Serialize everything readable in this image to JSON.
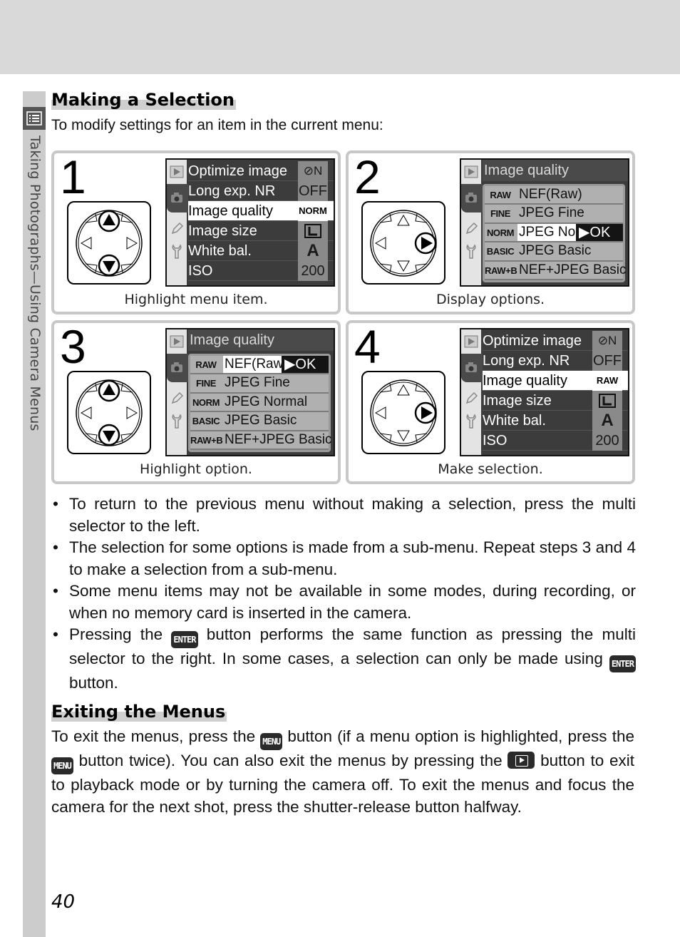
{
  "sidebar": {
    "icon": "menu-list-icon",
    "label": "Taking Photographs—Using Camera Menus"
  },
  "section1": {
    "title": "Making a Selection",
    "intro": "To modify settings for an item in the current menu:"
  },
  "steps": [
    {
      "number": "1",
      "caption": "Highlight menu item.",
      "selector_pressed": [
        "up",
        "down"
      ],
      "menu": {
        "rows": [
          {
            "label": "Optimize image",
            "value": "⊘N",
            "value_icon": "optimize-normal-icon"
          },
          {
            "label": "Long exp. NR",
            "value": "OFF"
          },
          {
            "label": "Image quality",
            "value": "NORM",
            "selected": true
          },
          {
            "label": "Image size",
            "value": "L",
            "value_icon": "image-size-large-icon"
          },
          {
            "label": "White bal.",
            "value": "A"
          },
          {
            "label": "ISO",
            "value": "200"
          }
        ]
      }
    },
    {
      "number": "2",
      "caption": "Display options.",
      "selector_pressed": [
        "right"
      ],
      "submenu": {
        "title": "Image quality",
        "rows": [
          {
            "code": "RAW",
            "option": "NEF(Raw)"
          },
          {
            "code": "FINE",
            "option": "JPEG Fine"
          },
          {
            "code": "NORM",
            "option": "JPEG Nor",
            "highlighted": true,
            "ok": "▶OK"
          },
          {
            "code": "BASIC",
            "option": "JPEG Basic"
          },
          {
            "code": "RAW+B",
            "option": "NEF+JPEG Basic"
          }
        ]
      }
    },
    {
      "number": "3",
      "caption": "Highlight option.",
      "selector_pressed": [
        "up",
        "down"
      ],
      "submenu": {
        "title": "Image quality",
        "rows": [
          {
            "code": "RAW",
            "option": "NEF(Raw)",
            "highlighted": true,
            "ok": "▶OK"
          },
          {
            "code": "FINE",
            "option": "JPEG Fine"
          },
          {
            "code": "NORM",
            "option": "JPEG Normal"
          },
          {
            "code": "BASIC",
            "option": "JPEG Basic"
          },
          {
            "code": "RAW+B",
            "option": "NEF+JPEG Basic"
          }
        ]
      }
    },
    {
      "number": "4",
      "caption": "Make selection.",
      "selector_pressed": [
        "right"
      ],
      "menu": {
        "rows": [
          {
            "label": "Optimize image",
            "value": "⊘N",
            "value_icon": "optimize-normal-icon"
          },
          {
            "label": "Long exp. NR",
            "value": "OFF"
          },
          {
            "label": "Image quality",
            "value": "RAW",
            "selected": true
          },
          {
            "label": "Image size",
            "value": "L",
            "value_icon": "image-size-large-icon"
          },
          {
            "label": "White bal.",
            "value": "A"
          },
          {
            "label": "ISO",
            "value": "200"
          }
        ]
      }
    }
  ],
  "bullets": [
    {
      "text": "To return to the previous menu without making a selection, press the multi selector to the left."
    },
    {
      "text": "The selection for some options is made from a sub-menu.  Repeat steps 3 and 4 to make a selection from a sub-menu."
    },
    {
      "text": "Some menu items may not be available in some modes, during recording, or when no memory card is inserted in the camera."
    },
    {
      "text_a": "Pressing the",
      "btn1": "ENTER",
      "text_b": "button performs the same function as pressing the multi selector to the right.  In some cases, a selection can only be made using",
      "btn2": "ENTER",
      "text_c": "button."
    }
  ],
  "section2": {
    "title": "Exiting the Menus",
    "p_a": "To exit the menus, press the",
    "btn_menu": "MENU",
    "p_b": "button (if a menu option is highlighted, press the",
    "p_c": "button twice).  You can also exit the menus by pressing the",
    "p_d": "button to exit to playback mode or by turning the camera off.  To exit the menus and focus the camera for the next shot, press the shutter-release button halfway."
  },
  "page_number": "40",
  "colors": {
    "header_band": "#d9d9d9",
    "sidebar": "#cccccc",
    "lcd_bg": "#3c3c3c",
    "panel_border": "#c8c8c8"
  }
}
